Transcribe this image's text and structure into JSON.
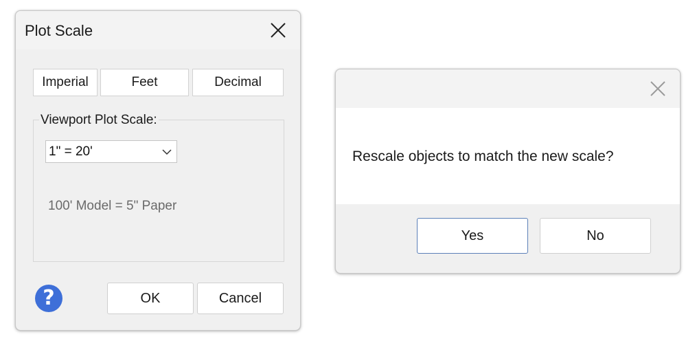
{
  "plot_scale_dialog": {
    "title": "Plot Scale",
    "close_icon": "close-icon",
    "tabs": [
      "Imperial",
      "Feet",
      "Decimal"
    ],
    "group_label": "Viewport Plot Scale:",
    "scale_select": {
      "selected": "1\" = 20'"
    },
    "ratio_text": "100' Model = 5\" Paper",
    "help_icon": {
      "name": "help-icon",
      "glyph": "?",
      "color": "#3e6fd8"
    },
    "buttons": {
      "ok": "OK",
      "cancel": "Cancel"
    }
  },
  "confirm_dialog": {
    "close_icon": "close-icon",
    "message": "Rescale objects to match the new scale?",
    "buttons": {
      "yes": "Yes",
      "no": "No"
    },
    "default_button_border": "#5b7fb8"
  }
}
